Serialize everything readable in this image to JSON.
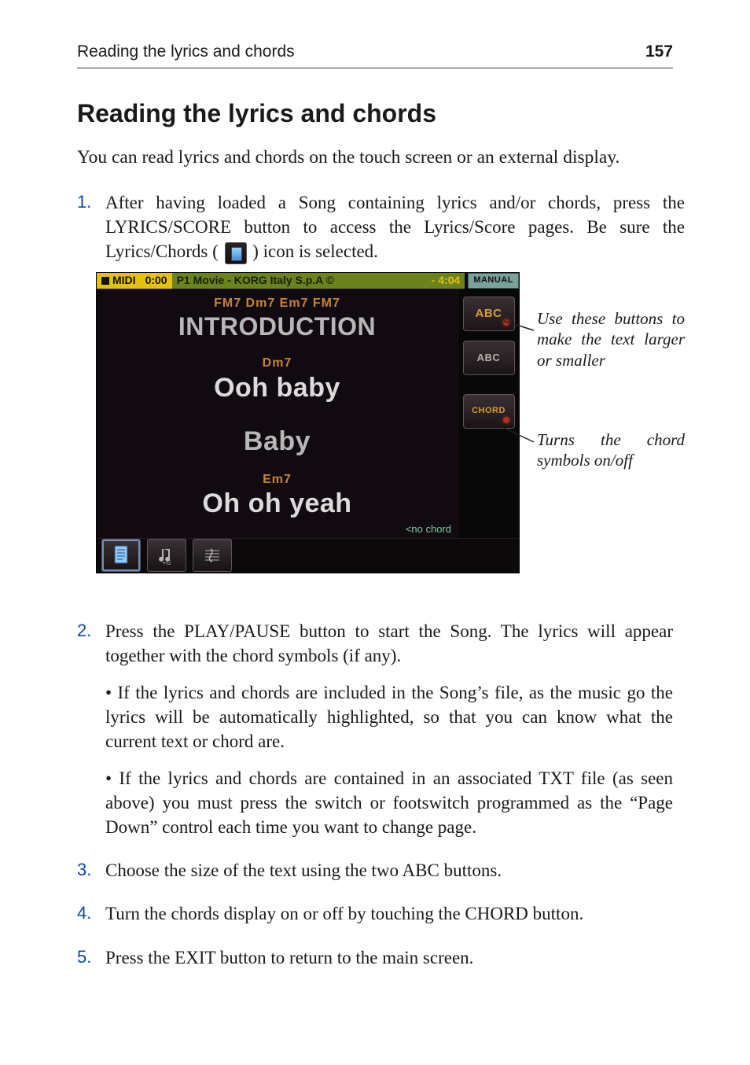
{
  "runhead": {
    "title": "Reading the lyrics and chords",
    "pageno": "157"
  },
  "section_title": "Reading the lyrics and chords",
  "intro": "You can read lyrics and chords on the touch screen or an external display.",
  "steps": {
    "s1": {
      "num": "1.",
      "text_a": "After having loaded a Song containing lyrics and/or chords, press the LYRICS/SCORE button to access the Lyrics/Score pages. Be sure the Lyrics/Chords (",
      "text_b": ") icon is selected."
    },
    "s2": {
      "num": "2.",
      "text": "Press the PLAY/PAUSE button to start the Song. The lyrics will appear together with the chord symbols (if any).",
      "bullet1": "• If the lyrics and chords are included in the Song’s file, as the music go the lyrics will be automatically highlighted, so that you can know what the current text or chord are.",
      "bullet2": "• If the lyrics and chords are contained in an associated TXT file (as seen above) you must press the switch or footswitch programmed as the “Page Down” control each time you want to change page."
    },
    "s3": {
      "num": "3.",
      "text": "Choose the size of the text using the two ABC buttons."
    },
    "s4": {
      "num": "4.",
      "text": "Turn the chords display on or off by touching the CHORD button."
    },
    "s5": {
      "num": "5.",
      "text": "Press the EXIT button to return to the main screen."
    }
  },
  "device": {
    "header": {
      "midi": "MIDI",
      "time_elapsed": "0:00",
      "track": "P1 Movie - KORG Italy S.p.A ©",
      "time_remaining": "- 4:04",
      "manual": "MANUAL"
    },
    "lyrics": {
      "chords_row_1": "FM7  Dm7  Em7  FM7",
      "line_1": "INTRODUCTION",
      "chord_2": "Dm7",
      "line_2": "Ooh baby",
      "line_3": "Baby",
      "chord_4": "Em7",
      "line_4": "Oh oh yeah",
      "no_chord": "<no chord"
    },
    "buttons": {
      "abc_large": "ABC",
      "abc_small": "ABC",
      "chord": "CHORD"
    }
  },
  "callouts": {
    "abc": "Use these buttons to make the text larger or smaller",
    "chord": "Turns the chord symbols on/off"
  }
}
